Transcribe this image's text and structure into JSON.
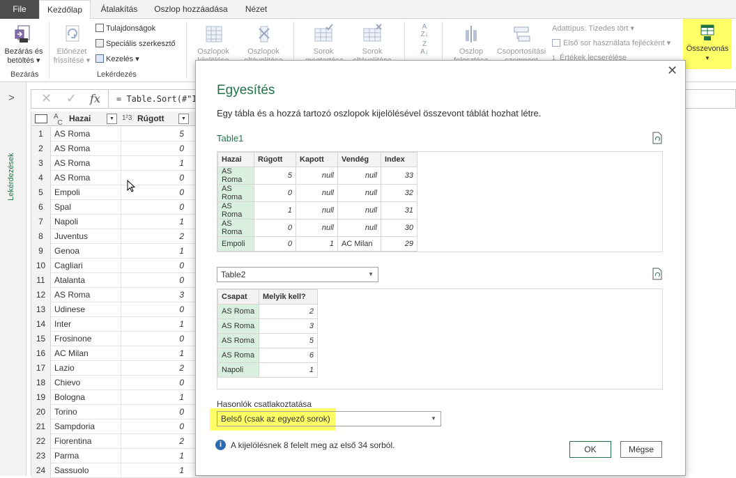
{
  "tabs": {
    "file": "File",
    "home": "Kezdőlap",
    "transform": "Átalakítás",
    "add_column": "Oszlop hozzáadása",
    "view": "Nézet"
  },
  "ribbon": {
    "close_load": "Bezárás és betöltés",
    "close_load_l1": "Bezárás és",
    "close_load_l2": "betöltés",
    "refresh_l1": "Előnézet",
    "refresh_l2": "frissítése",
    "properties": "Tulajdonságok",
    "advanced_editor": "Speciális szerkesztő",
    "manage": "Kezelés",
    "group_close": "Bezárás",
    "group_query": "Lekérdezés",
    "choose_cols_l1": "Oszlopok",
    "choose_cols_l2": "kijelölése",
    "remove_cols_l1": "Oszlopok",
    "remove_cols_l2": "eltávolítása",
    "keep_rows_l1": "Sorok",
    "keep_rows_l2": "megtartása",
    "remove_rows_l1": "Sorok",
    "remove_rows_l2": "eltávolítása",
    "split_l1": "Oszlop",
    "split_l2": "felosztása",
    "group_by_l1": "Csoportosítási",
    "group_by_l2": "szempont",
    "data_type": "Adattípus: Tizedes tört",
    "first_row_headers": "Első sor használata fejlécként",
    "replace_values": "Értékek lecserélése",
    "combine": "Összevonás"
  },
  "side": {
    "queries_label": "Lekérdezések"
  },
  "formula": {
    "text": "= Table.Sort(#\"In"
  },
  "grid": {
    "col1": "Hazai",
    "col2": "Rúgott",
    "rows": [
      {
        "n": "1",
        "team": "AS Roma",
        "v": "5"
      },
      {
        "n": "2",
        "team": "AS Roma",
        "v": "0"
      },
      {
        "n": "3",
        "team": "AS Roma",
        "v": "1"
      },
      {
        "n": "4",
        "team": "AS Roma",
        "v": "0"
      },
      {
        "n": "5",
        "team": "Empoli",
        "v": "0"
      },
      {
        "n": "6",
        "team": "Spal",
        "v": "0"
      },
      {
        "n": "7",
        "team": "Napoli",
        "v": "1"
      },
      {
        "n": "8",
        "team": "Juventus",
        "v": "2"
      },
      {
        "n": "9",
        "team": "Genoa",
        "v": "1"
      },
      {
        "n": "10",
        "team": "Cagliari",
        "v": "0"
      },
      {
        "n": "11",
        "team": "Atalanta",
        "v": "0"
      },
      {
        "n": "12",
        "team": "AS Roma",
        "v": "3"
      },
      {
        "n": "13",
        "team": "Udinese",
        "v": "0"
      },
      {
        "n": "14",
        "team": "Inter",
        "v": "1"
      },
      {
        "n": "15",
        "team": "Frosinone",
        "v": "0"
      },
      {
        "n": "16",
        "team": "AC Milan",
        "v": "1"
      },
      {
        "n": "17",
        "team": "Lazio",
        "v": "2"
      },
      {
        "n": "18",
        "team": "Chievo",
        "v": "0"
      },
      {
        "n": "19",
        "team": "Bologna",
        "v": "1"
      },
      {
        "n": "20",
        "team": "Torino",
        "v": "0"
      },
      {
        "n": "21",
        "team": "Sampdoria",
        "v": "0"
      },
      {
        "n": "22",
        "team": "Fiorentina",
        "v": "2"
      },
      {
        "n": "23",
        "team": "Parma",
        "v": "1"
      },
      {
        "n": "24",
        "team": "Sassuolo",
        "v": "1"
      }
    ]
  },
  "dialog": {
    "title": "Egyesítés",
    "description": "Egy tábla és a hozzá tartozó oszlopok kijelölésével összevont táblát hozhat létre.",
    "table1_name": "Table1",
    "table1_headers": [
      "Hazai",
      "Rúgott",
      "Kapott",
      "Vendég",
      "Index"
    ],
    "table1_rows": [
      [
        "AS Roma",
        "5",
        "null",
        "null",
        "33"
      ],
      [
        "AS Roma",
        "0",
        "null",
        "null",
        "32"
      ],
      [
        "AS Roma",
        "1",
        "null",
        "null",
        "31"
      ],
      [
        "AS Roma",
        "0",
        "null",
        "null",
        "30"
      ],
      [
        "Empoli",
        "0",
        "1",
        "AC Milan",
        "29"
      ]
    ],
    "table2_select": "Table2",
    "table2_headers": [
      "Csapat",
      "Melyik kell?"
    ],
    "table2_rows": [
      [
        "AS Roma",
        "2"
      ],
      [
        "AS Roma",
        "3"
      ],
      [
        "AS Roma",
        "5"
      ],
      [
        "AS Roma",
        "6"
      ],
      [
        "Napoli",
        "1"
      ]
    ],
    "join_label": "Hasonlók csatlakoztatása",
    "join_value": "Belső (csak az egyező sorok)",
    "info": "A kijelölésnek 8 felelt meg az első 34 sorból.",
    "ok": "OK",
    "cancel": "Mégse"
  },
  "colors": {
    "accent": "#217346",
    "highlight": "#ffff66",
    "key_cell": "#d9efdf"
  }
}
